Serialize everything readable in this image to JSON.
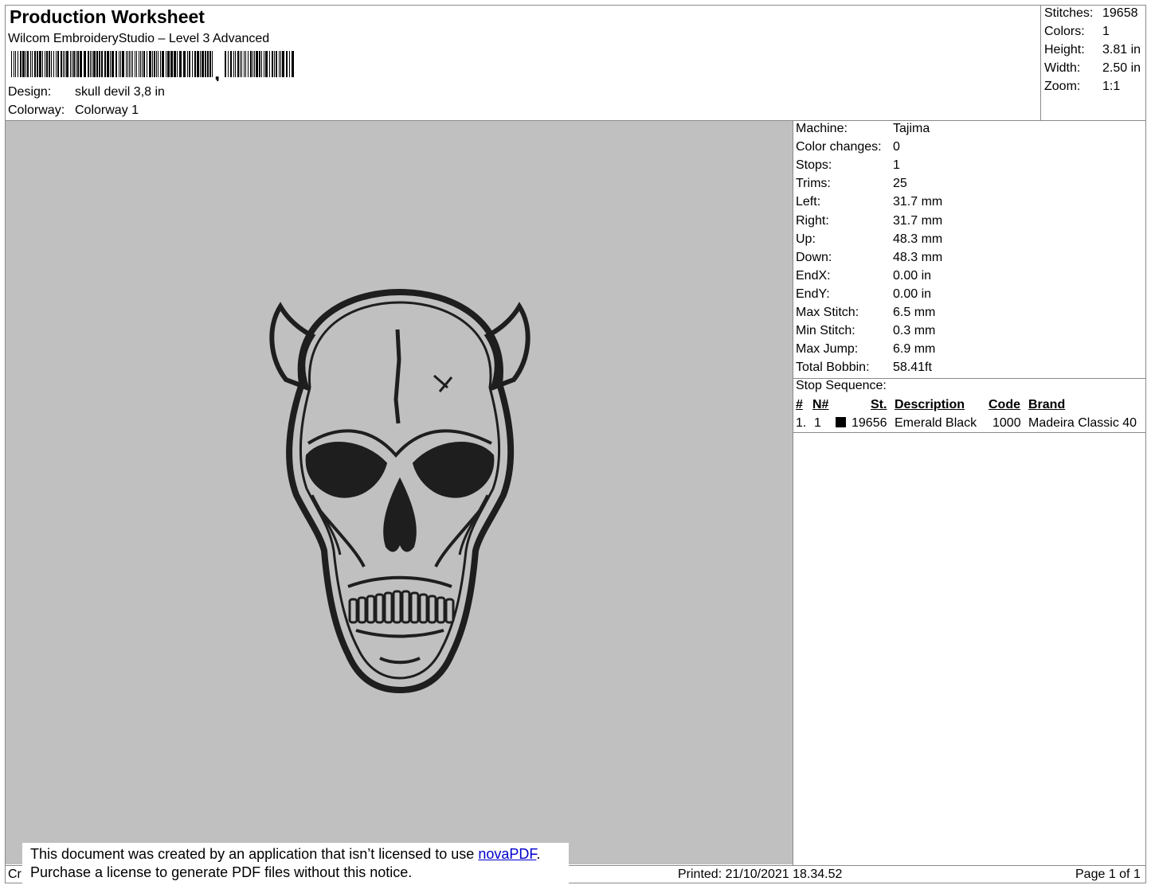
{
  "header": {
    "title": "Production Worksheet",
    "software": "Wilcom EmbroideryStudio – Level 3 Advanced",
    "design_label": "Design:",
    "design_value": "skull devil 3,8 in",
    "colorway_label": "Colorway:",
    "colorway_value": "Colorway 1"
  },
  "summary": {
    "stitches_label": "Stitches:",
    "stitches_value": "19658",
    "colors_label": "Colors:",
    "colors_value": "1",
    "height_label": "Height:",
    "height_value": "3.81 in",
    "width_label": "Width:",
    "width_value": "2.50 in",
    "zoom_label": "Zoom:",
    "zoom_value": "1:1"
  },
  "details": [
    {
      "label": "Machine:",
      "value": "Tajima"
    },
    {
      "label": "Color changes:",
      "value": "0"
    },
    {
      "label": "Stops:",
      "value": "1"
    },
    {
      "label": "Trims:",
      "value": "25"
    },
    {
      "label": "Left:",
      "value": "31.7 mm"
    },
    {
      "label": "Right:",
      "value": "31.7 mm"
    },
    {
      "label": "Up:",
      "value": "48.3 mm"
    },
    {
      "label": "Down:",
      "value": "48.3 mm"
    },
    {
      "label": "EndX:",
      "value": "0.00 in"
    },
    {
      "label": "EndY:",
      "value": "0.00 in"
    },
    {
      "label": "Max Stitch:",
      "value": "6.5 mm"
    },
    {
      "label": "Min Stitch:",
      "value": "0.3 mm"
    },
    {
      "label": "Max Jump:",
      "value": "6.9 mm"
    },
    {
      "label": "Total Bobbin:",
      "value": "58.41ft"
    }
  ],
  "stop_sequence": {
    "title": "Stop Sequence:",
    "headers": {
      "num": "#",
      "n": "N#",
      "st": "St.",
      "description": "Description",
      "code": "Code",
      "brand": "Brand"
    },
    "rows": [
      {
        "num": "1.",
        "n": "1",
        "color": "#000000",
        "st": "19656",
        "description": "Emerald Black",
        "code": "1000",
        "brand": "Madeira Classic 40"
      }
    ]
  },
  "footer": {
    "created_prefix": "Cr",
    "printed": "Printed: 21/10/2021 18.34.52",
    "page": "Page 1 of 1"
  },
  "notice": {
    "line1_text": "This document was created by an application that isn’t licensed to use ",
    "link_text": "novaPDF",
    "line1_end": ".",
    "line2_text": "Purchase a license to generate PDF files without this notice."
  },
  "design_image": {
    "icon": "skull-devil-embroidery",
    "background_color": "#c0c0c0",
    "thread_color": "#1e1e1e"
  }
}
